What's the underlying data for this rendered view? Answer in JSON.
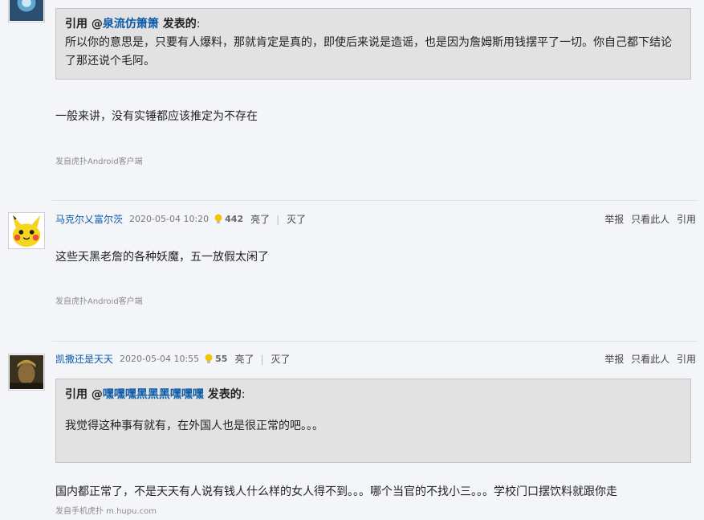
{
  "post1": {
    "quote_prefix": "引用 @",
    "quote_user": "泉流仿箫箫",
    "quote_suffix": " 发表的",
    "quote_colon": ":",
    "quote_text": "所以你的意思是，只要有人爆料，那就肯定是真的，即使后来说是造谣，也是因为詹姆斯用钱摆平了一切。你自己都下结论了那还说个毛阿。",
    "body": "一般来讲，没有实锤都应该推定为不存在",
    "source": "发自虎扑Android客户端"
  },
  "post2": {
    "username": "马克尔乂富尔茨",
    "date": "2020-05-04 10:20",
    "light_count": "442",
    "light_label": "亮了",
    "sep": "|",
    "dark_label": "灭了",
    "report": "举报",
    "only_this": "只看此人",
    "quote_btn": "引用",
    "body": "这些天黑老詹的各种妖魔，五一放假太闲了",
    "source": "发自虎扑Android客户端"
  },
  "post3": {
    "username": "凯撒还是天天",
    "date": "2020-05-04 10:55",
    "light_count": "55",
    "light_label": "亮了",
    "sep": "|",
    "dark_label": "灭了",
    "report": "举报",
    "only_this": "只看此人",
    "quote_btn": "引用",
    "quote_prefix": "引用 @",
    "quote_user": "嘿嘿嘿黑黑黑嘿嘿嘿",
    "quote_suffix": " 发表的",
    "quote_colon": ":",
    "quote_text": "我觉得这种事有就有，在外国人也是很正常的吧。。。",
    "body": "国内都正常了，不是天天有人说有钱人什么样的女人得不到。。。哪个当官的不找小三。。。学校门口摆饮料就跟你走",
    "source": "发自手机虎扑 m.hupu.com"
  },
  "colors": {
    "link": "#0b5aa8",
    "quote_bg": "#e2e2e2",
    "page_bg": "#f4f5f9"
  }
}
